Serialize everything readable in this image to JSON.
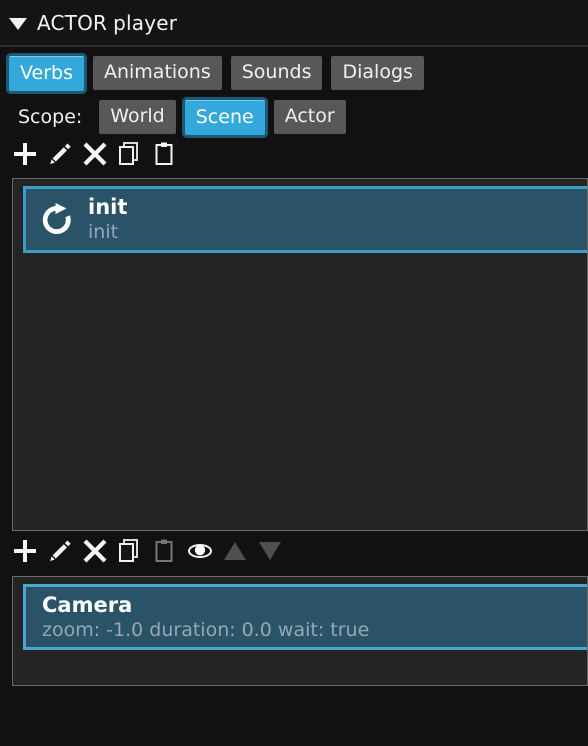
{
  "window": {
    "collapse_icon": "triangle-down-icon",
    "type_label": "ACTOR",
    "name_label": "player"
  },
  "tabs": [
    {
      "label": "Verbs",
      "active": true
    },
    {
      "label": "Animations",
      "active": false
    },
    {
      "label": "Sounds",
      "active": false
    },
    {
      "label": "Dialogs",
      "active": false
    }
  ],
  "scope": {
    "label": "Scope:",
    "options": [
      {
        "label": "World",
        "active": false
      },
      {
        "label": "Scene",
        "active": true
      },
      {
        "label": "Actor",
        "active": false
      }
    ]
  },
  "verb_toolbar": [
    {
      "icon": "plus-icon",
      "enabled": true
    },
    {
      "icon": "pencil-icon",
      "enabled": true
    },
    {
      "icon": "delete-x-icon",
      "enabled": true
    },
    {
      "icon": "copy-icon",
      "enabled": true
    },
    {
      "icon": "paste-icon",
      "enabled": true
    }
  ],
  "verb_list": [
    {
      "icon": "refresh-loop-icon",
      "title": "init",
      "subtitle": "init",
      "selected": true
    }
  ],
  "action_toolbar": [
    {
      "icon": "plus-icon",
      "enabled": true
    },
    {
      "icon": "pencil-icon",
      "enabled": true
    },
    {
      "icon": "delete-x-icon",
      "enabled": true
    },
    {
      "icon": "copy-icon",
      "enabled": true
    },
    {
      "icon": "paste-icon",
      "enabled": false
    },
    {
      "icon": "eye-icon",
      "enabled": true
    },
    {
      "icon": "move-up-icon",
      "enabled": false
    },
    {
      "icon": "move-down-icon",
      "enabled": false
    }
  ],
  "action_list": [
    {
      "title": "Camera",
      "subtitle": "zoom: -1.0 duration: 0.0 wait: true",
      "selected": true
    }
  ],
  "colors": {
    "accent": "#34a8db",
    "selection_fill": "#2b5368",
    "selection_border": "#3e9cc4",
    "button_inactive": "#585858",
    "panel_bg": "#242424",
    "window_bg": "#111111",
    "subtitle_text": "#93a9b4"
  }
}
